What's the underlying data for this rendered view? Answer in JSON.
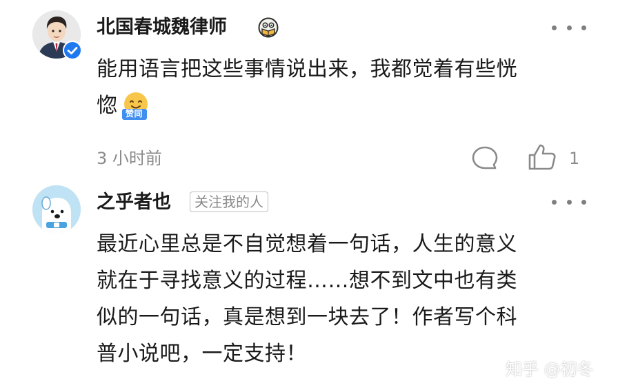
{
  "comments": [
    {
      "author": "北国春城魏律师",
      "badge_icon": "reading-owl-badge-icon",
      "verified_icon": "verified-check-icon",
      "text_line1": "能用语言把这些事情说出来，我都觉着有些恍",
      "text_line2": "惚",
      "sticker_text": "赞同",
      "time": "3 小时前",
      "like_count": "1"
    },
    {
      "author": "之乎者也",
      "tag": "关注我的人",
      "text_lines": [
        "最近心里总是不自觉想着一句话，人生的意义",
        "就在于寻找意义的过程……想不到文中也有类",
        "似的一句话，真是想到一块去了！作者写个科",
        "普小说吧，一定支持！"
      ]
    }
  ],
  "watermark": "知乎 @初冬",
  "colors": {
    "verified_blue": "#1e78f0",
    "secondary_text": "#8a8a8a",
    "sticker_yellow": "#f7c64a",
    "sticker_blue": "#3f8ef0"
  }
}
